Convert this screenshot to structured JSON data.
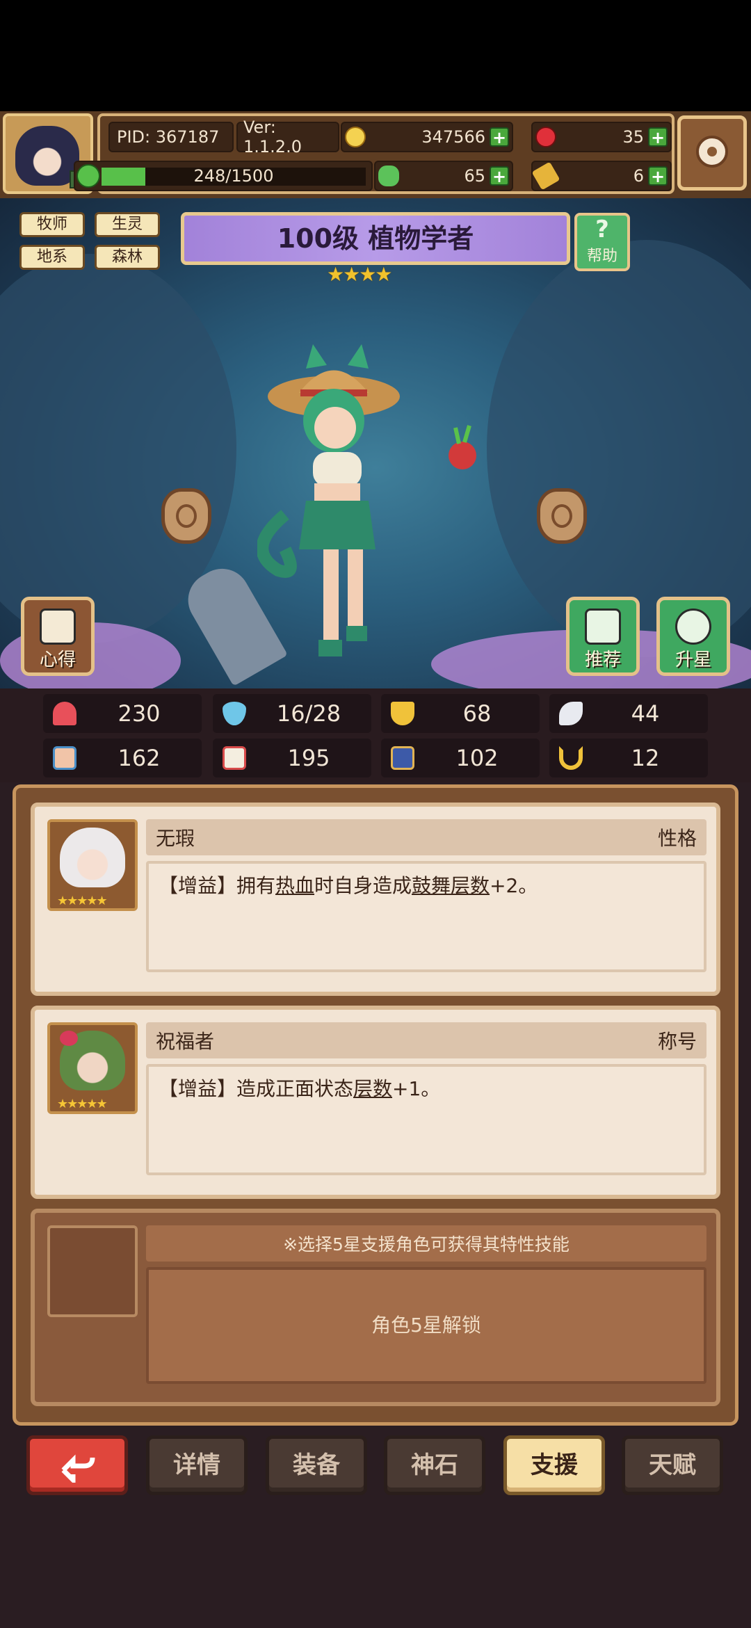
{
  "header": {
    "pid": "PID: 367187",
    "version": "Ver: 1.1.2.0",
    "gold": "347566",
    "red_gem": "35",
    "energy": "248/1500",
    "clover": "65",
    "key": "6",
    "energy_fraction": 0.165
  },
  "tags": [
    "牧师",
    "生灵",
    "地系",
    "森林"
  ],
  "title": {
    "text": "100级 植物学者",
    "stars": "★★★★",
    "help_label": "帮助"
  },
  "scene_buttons": {
    "insight": "心得",
    "recommend": "推荐",
    "star_up": "升星"
  },
  "stats": [
    {
      "icon": "heart-icon",
      "value": "230",
      "color": "#e8505a"
    },
    {
      "icon": "water-drop-icon",
      "value": "16/28",
      "color": "#6fc6e8"
    },
    {
      "icon": "shield-icon",
      "value": "68",
      "color": "#f0c23a"
    },
    {
      "icon": "wing-icon",
      "value": "44",
      "color": "#e8eaf0"
    },
    {
      "icon": "fist-icon",
      "value": "162",
      "color": "#f1c4a8"
    },
    {
      "icon": "book-icon",
      "value": "195",
      "color": "#d84a4a"
    },
    {
      "icon": "boot-icon",
      "value": "102",
      "color": "#e2b454"
    },
    {
      "icon": "horseshoe-icon",
      "value": "12",
      "color": "#f0c23a"
    }
  ],
  "support_cards": [
    {
      "name": "无瑕",
      "type": "性格",
      "stars": "★★★★★",
      "desc_prefix": "【增益】拥有",
      "desc_u1": "热血",
      "desc_mid": "时自身造成",
      "desc_u2": "鼓舞层数",
      "desc_suffix": "+2。"
    },
    {
      "name": "祝福者",
      "type": "称号",
      "stars": "★★★★★",
      "desc_prefix": "【增益】造成正面状态",
      "desc_u1": "层数",
      "desc_suffix": "+1。"
    }
  ],
  "locked_slot": {
    "hint": "※选择5星支援角色可获得其特性技能",
    "lock_text": "角色5星解锁"
  },
  "bottom_nav": {
    "details": "详情",
    "equipment": "装备",
    "god_stone": "神石",
    "support": "支援",
    "talent": "天赋"
  }
}
